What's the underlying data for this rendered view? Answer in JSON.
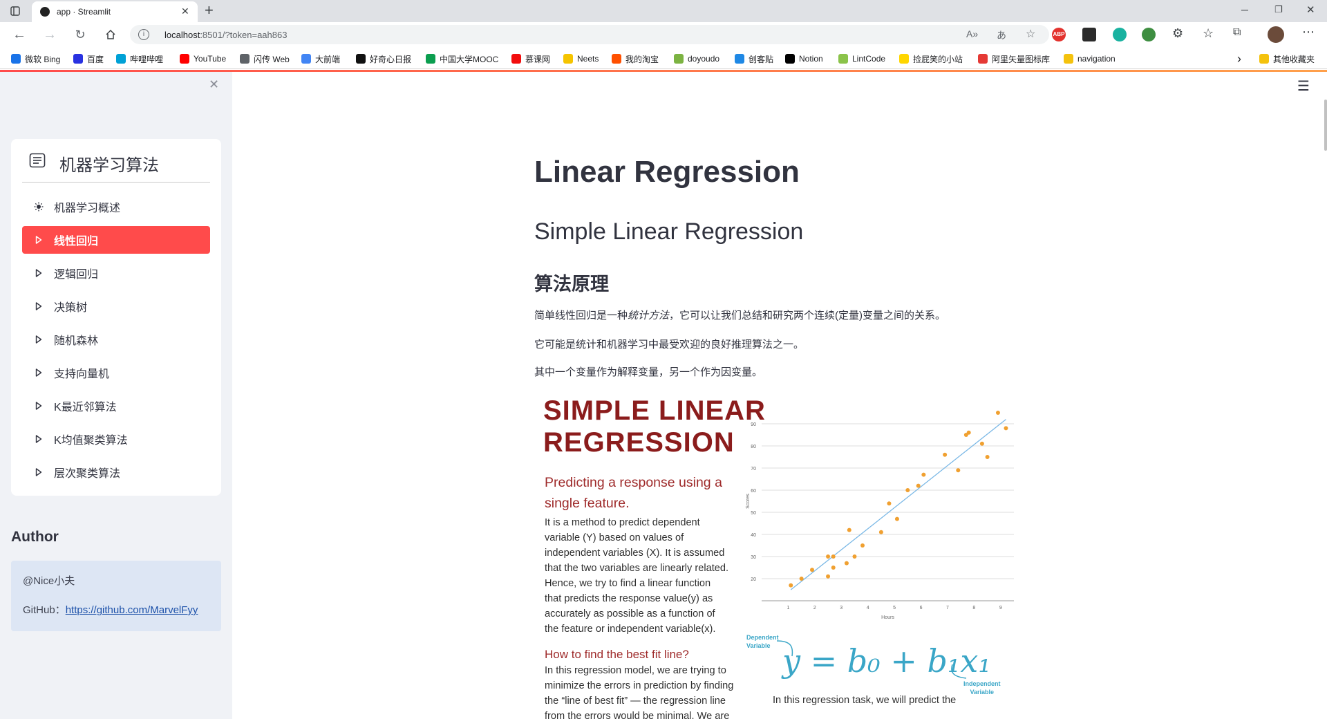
{
  "browser": {
    "tab_title": "app · Streamlit",
    "url_host": "localhost",
    "url_rest": ":8501/?token=aah863",
    "bookmarks": [
      {
        "label": "微软 Bing",
        "color": "#1a73e8"
      },
      {
        "label": "百度",
        "color": "#2932e1"
      },
      {
        "label": "哔哩哔哩",
        "color": "#00a1d6"
      },
      {
        "label": "YouTube",
        "color": "#ff0000"
      },
      {
        "label": "闪传 Web",
        "color": "#5f6368"
      },
      {
        "label": "大前端",
        "color": "#4285f4"
      },
      {
        "label": "好奇心日报",
        "color": "#111111"
      },
      {
        "label": "中国大学MOOC",
        "color": "#0b9e4f"
      },
      {
        "label": "慕课网",
        "color": "#f20d0d"
      },
      {
        "label": "Neets",
        "color": "#f5c400"
      },
      {
        "label": "我的淘宝",
        "color": "#ff5000"
      },
      {
        "label": "doyoudo",
        "color": "#7cb342"
      },
      {
        "label": "创客贴",
        "color": "#1e88e5"
      },
      {
        "label": "Notion",
        "color": "#000000"
      },
      {
        "label": "LintCode",
        "color": "#8bc34a"
      },
      {
        "label": "捡屁笑的小站",
        "color": "#ffd600"
      },
      {
        "label": "阿里矢量图标库",
        "color": "#e53935"
      },
      {
        "label": "navigation",
        "color": "#f4c20d"
      }
    ],
    "other_bookmarks": "其他收藏夹"
  },
  "sidebar": {
    "menu_title": "机器学习算法",
    "items": [
      {
        "label": "机器学习概述",
        "icon": "sun-icon",
        "active": false
      },
      {
        "label": "线性回归",
        "icon": "caret-right-icon",
        "active": true
      },
      {
        "label": "逻辑回归",
        "icon": "caret-right-icon",
        "active": false
      },
      {
        "label": "决策树",
        "icon": "caret-right-icon",
        "active": false
      },
      {
        "label": "随机森林",
        "icon": "caret-right-icon",
        "active": false
      },
      {
        "label": "支持向量机",
        "icon": "caret-right-icon",
        "active": false
      },
      {
        "label": "K最近邻算法",
        "icon": "caret-right-icon",
        "active": false
      },
      {
        "label": "K均值聚类算法",
        "icon": "caret-right-icon",
        "active": false
      },
      {
        "label": "层次聚类算法",
        "icon": "caret-right-icon",
        "active": false
      }
    ],
    "author_heading": "Author",
    "author_name": "@Nice小夫",
    "github_label": "GitHub：",
    "github_link": "https://github.com/MarvelFyy"
  },
  "main": {
    "title": "Linear Regression",
    "subtitle": "Simple Linear Regression",
    "section": "算法原理",
    "para1_before": "简单线性回归是一种",
    "para1_em": "统计方法",
    "para1_after": "，它可以让我们总结和研究两个连续(定量)变量之间的关系。",
    "para2": "它可能是统计和机器学习中最受欢迎的良好推理算法之一。",
    "para3": "其中一个变量作为解释变量，另一个作为因变量。"
  },
  "figure": {
    "title_line1": "SIMPLE LINEAR",
    "title_line2": "REGRESSION",
    "subtitle_line1": "Predicting a response using a",
    "subtitle_line2": "single feature.",
    "body_lines": [
      "It is a method to predict dependent",
      "variable (Y) based on values of",
      "independent variables (X). It is assumed",
      "that the two variables are linearly related.",
      "Hence, we try to find a linear function",
      "that predicts the response value(y) as",
      "accurately as possible as a function of",
      "the feature or independent variable(x)."
    ],
    "question": "How to find the best fit line?",
    "q_lines": [
      "In this regression model, we are trying to",
      "minimize the errors in prediction by finding",
      "the “line of best fit” — the regression line",
      "from the errors would be minimal. We are"
    ],
    "dep_label_1": "Dependent",
    "dep_label_2": "Variable",
    "indep_label_1": "Independent",
    "indep_label_2": "Variable",
    "eq_y": "y",
    "eq_eq": "=",
    "eq_b0": "b₀",
    "eq_plus": "+",
    "eq_b1x1": "b₁x₁",
    "bottom_text": "In this regression task, we will predict the"
  },
  "chart_data": {
    "type": "scatter",
    "xlabel": "Hours",
    "ylabel": "Scores",
    "xlim": [
      0,
      9.5
    ],
    "ylim": [
      10,
      100
    ],
    "x_ticks": [
      1,
      2,
      3,
      4,
      5,
      6,
      7,
      8,
      9
    ],
    "y_ticks": [
      20,
      30,
      40,
      50,
      60,
      70,
      80,
      90
    ],
    "points": [
      [
        1.1,
        17
      ],
      [
        1.5,
        20
      ],
      [
        1.9,
        24
      ],
      [
        2.5,
        21
      ],
      [
        2.5,
        30
      ],
      [
        2.7,
        25
      ],
      [
        2.7,
        30
      ],
      [
        3.2,
        27
      ],
      [
        3.3,
        42
      ],
      [
        3.5,
        30
      ],
      [
        3.8,
        35
      ],
      [
        4.5,
        41
      ],
      [
        4.8,
        54
      ],
      [
        5.1,
        47
      ],
      [
        5.5,
        60
      ],
      [
        5.9,
        62
      ],
      [
        6.1,
        67
      ],
      [
        6.9,
        76
      ],
      [
        7.4,
        69
      ],
      [
        7.7,
        85
      ],
      [
        7.8,
        86
      ],
      [
        8.3,
        81
      ],
      [
        8.5,
        75
      ],
      [
        8.9,
        95
      ],
      [
        9.2,
        88
      ]
    ],
    "fit_line": [
      [
        1.1,
        15
      ],
      [
        9.2,
        92
      ]
    ],
    "colors": {
      "points": "#f0a030",
      "line": "#7ab8e6",
      "grid": "#dddddd"
    }
  },
  "colors": {
    "accent": "#ff4b4b",
    "sidebar_bg": "#f0f2f6",
    "info_bg": "#dde6f4",
    "figure_title": "#8b1c1c",
    "figure_sub": "#9e2a2a",
    "equation": "#3aa6c7"
  }
}
